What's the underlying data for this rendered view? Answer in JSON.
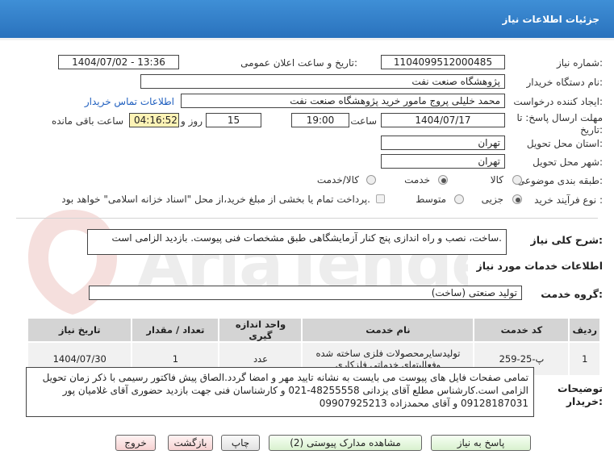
{
  "header": {
    "title": "جزئیات اطلاعات نیاز"
  },
  "fields": {
    "need_number_label": "شماره نیاز:",
    "need_number": "1104099512000485",
    "announce_label": "تاریخ و ساعت اعلان عمومی:",
    "announce_value": "1404/07/02 - 13:36",
    "buyer_org_label": "نام دستگاه خریدار:",
    "buyer_org": "پژوهشگاه صنعت نفت",
    "requester_label": "ایجاد کننده درخواست:",
    "requester": "محمد خلیلی پروج مامور خرید پژوهشگاه صنعت نفت",
    "contact_link": "اطلاعات تماس خریدار",
    "deadline_label": "مهلت ارسال پاسخ: تا تاریخ:",
    "deadline_date": "1404/07/17",
    "time_label": "ساعت",
    "deadline_time": "19:00",
    "days_value": "15",
    "days_label": "روز و",
    "remaining_time": "04:16:52",
    "remaining_label": "ساعت باقی مانده",
    "province_label": "استان محل تحویل:",
    "province": "تهران",
    "city_label": "شهر محل تحویل:",
    "city": "تهران",
    "category_label": "طبقه بندی موضوعی:",
    "category_options": [
      "کالا",
      "خدمت",
      "کالا/خدمت"
    ],
    "category_selected": "خدمت",
    "process_label": "نوع فرآیند خرید :",
    "process_options": [
      "جزیی",
      "متوسط"
    ],
    "process_selected": "جزیی",
    "payment_note": "پرداخت تمام یا بخشی از مبلغ خرید،از محل \"اسناد خزانه اسلامی\" خواهد بود."
  },
  "summary": {
    "label": "شرح کلی نیاز:",
    "text": "ساخت، نصب و راه اندازی پنج کنار آزمایشگاهی طبق مشخصات فنی پیوست. بازدید الزامی است."
  },
  "services": {
    "section_title": "اطلاعات خدمات مورد نیاز",
    "group_label": "گروه خدمت:",
    "group_value": "تولید صنعتی (ساخت)",
    "columns": [
      "ردیف",
      "کد خدمت",
      "نام خدمت",
      "واحد اندازه گیری",
      "تعداد / مقدار",
      "تاریخ نیاز"
    ],
    "rows": [
      {
        "row": "1",
        "code": "پ-25-259",
        "name": "تولیدسایرمحصولات فلزی ساخته شده وفعالیتهای خدماتی فلزکاری",
        "unit": "عدد",
        "qty": "1",
        "date": "1404/07/30"
      }
    ]
  },
  "buyer_notes": {
    "label": "توضیحات خریدار:",
    "text": "تمامی صفحات فایل های پیوست می بایست به نشانه تایید مهر و امضا گردد.الصاق پیش فاکتور رسیمی با ذکر زمان تحویل الزامی است.کارشناس مطلع آقای یزدانی 48255558-021 و کارشناسان فنی جهت بازدید حضوری آقای غلامیان پور 09128187031 و آقای محمدزاده 09907925213"
  },
  "buttons": {
    "respond": "پاسخ به نیاز",
    "view_docs": "مشاهده مدارک پیوستی (2)",
    "print": "چاپ",
    "back": "بازگشت",
    "exit": "خروج"
  },
  "watermark": {
    "text": "AriaTender.neT"
  },
  "colors": {
    "header": "#2f7fc9",
    "link": "#1f5fbf",
    "remaining_bg": "#fdf3b6"
  }
}
